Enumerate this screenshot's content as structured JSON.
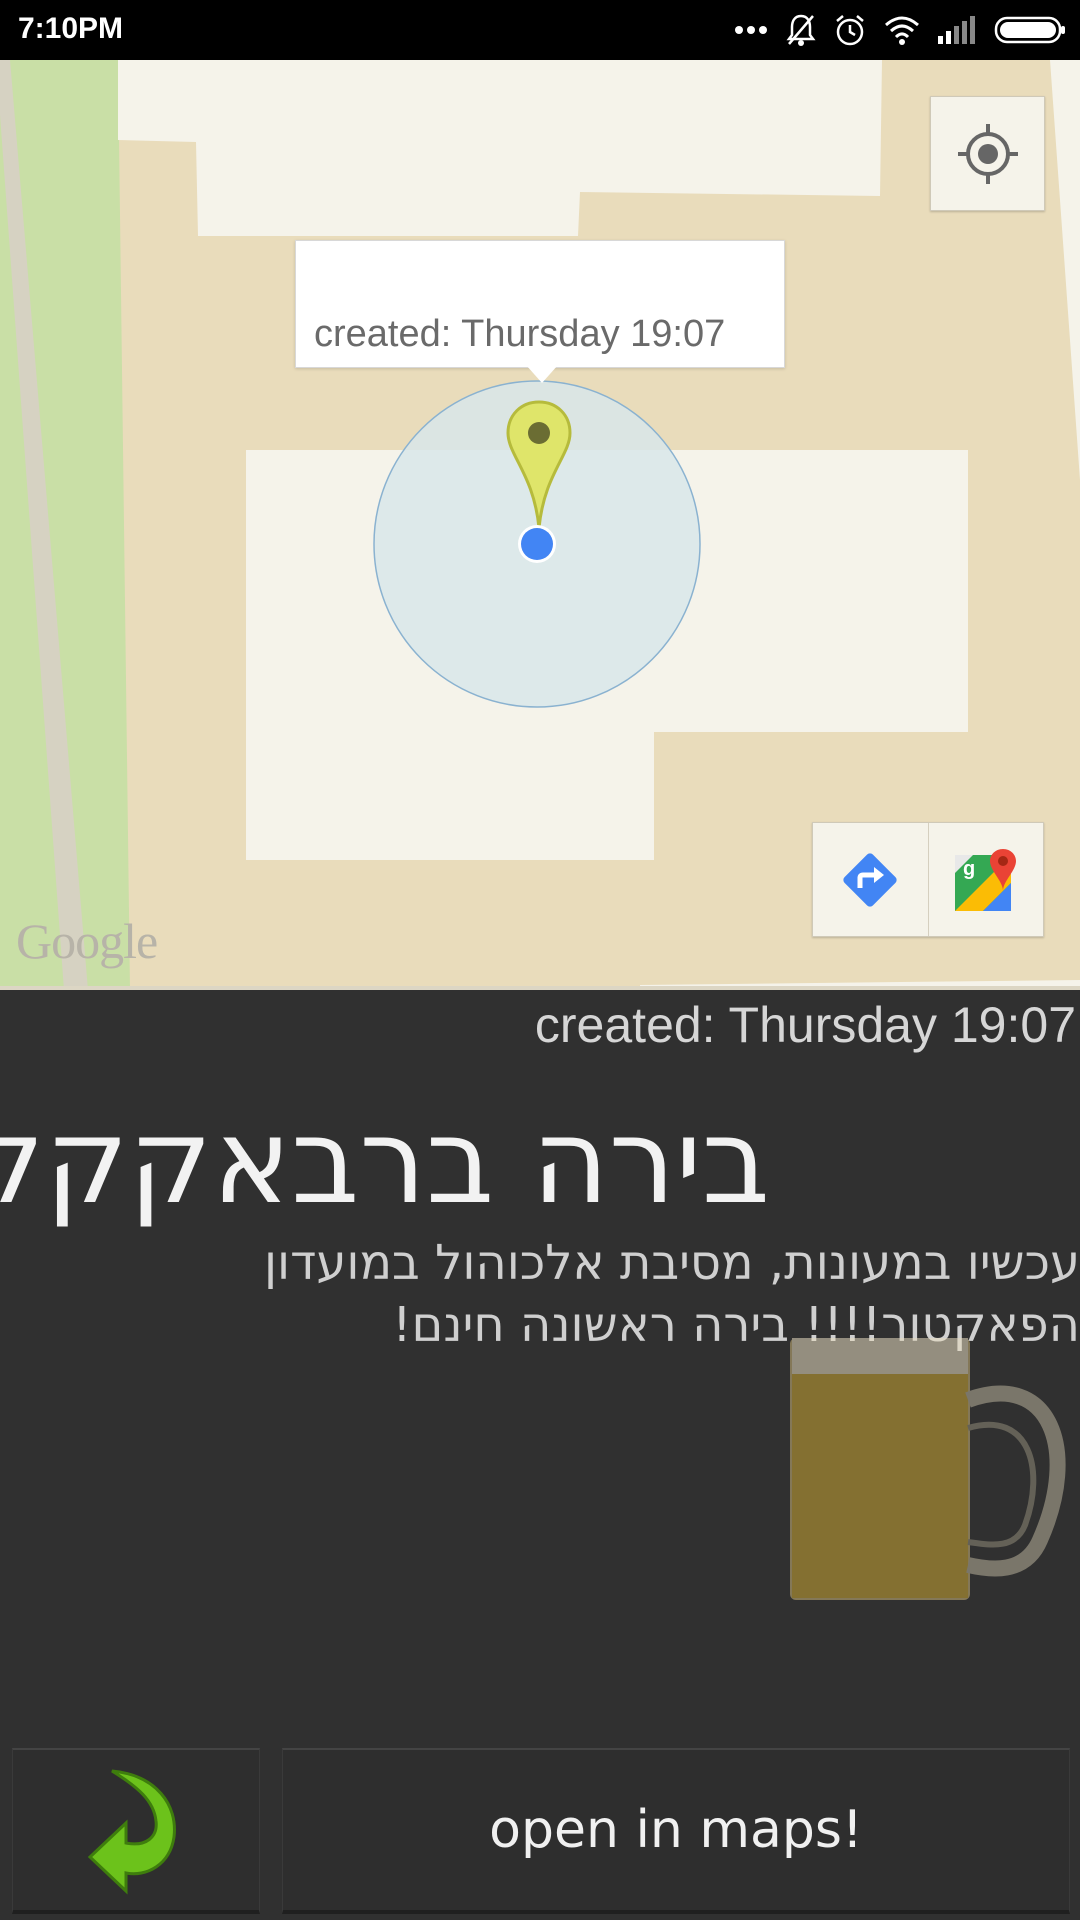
{
  "status_bar": {
    "time": "7:10PM",
    "icons": [
      "more-icon",
      "muted-bell-icon",
      "alarm-icon",
      "wifi-icon",
      "signal-icon",
      "battery-icon"
    ]
  },
  "map": {
    "info_window_text": "created: Thursday 19:07",
    "attribution": "Google",
    "controls": [
      "my-location-icon",
      "directions-icon",
      "google-maps-icon"
    ]
  },
  "event": {
    "created": "created: Thursday 19:07",
    "title": "בירה ברבאקקק",
    "description": "עכשיו במעונות, מסיבת אלכוהול במועדון הפאקטור!!!! בירה ראשונה חינם!",
    "image": "beer-mug-image"
  },
  "buttons": {
    "back_icon": "back-arrow-icon",
    "open_maps": "open in maps!"
  },
  "colors": {
    "map_land": "#e9dcbb",
    "map_building": "#f5f3ea",
    "map_park": "#c9dfa6",
    "accuracy_circle": "#d8e6ea",
    "location_dot": "#4285f4",
    "marker": "#dfe56a",
    "background": "#303030",
    "back_arrow": "#6cc21b"
  }
}
